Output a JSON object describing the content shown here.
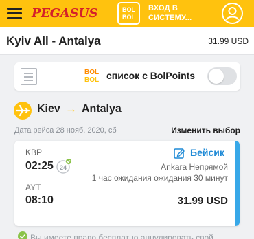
{
  "header": {
    "brand": "PEGASUS",
    "bolbol_badge": [
      "BOL",
      "BOL"
    ],
    "login_lines": [
      "ВХОД В",
      "СИСТЕМУ..."
    ]
  },
  "route": {
    "title": "Kyiv All  -  Antalya",
    "price": "31.99 USD"
  },
  "bolpoints": {
    "logo": [
      "BOL",
      "BOL"
    ],
    "label": "список с BolPoints",
    "toggle_on": false
  },
  "leg": {
    "from": "Kiev",
    "arrow": "→",
    "to": "Antalya",
    "date": "Дата рейса 28 нояб. 2020, сб",
    "change_link": "Изменить выбор"
  },
  "flight": {
    "departure_code": "KBP",
    "departure_time": "02:25",
    "badge_number": "24",
    "fare_name": "Бейсик",
    "transfer": "Ankara Непрямой",
    "layover": "1 час ожидания ожидания 30 минут",
    "arrival_code": "AYT",
    "arrival_time": "08:10",
    "price": "31.99 USD"
  },
  "notice": {
    "text": "Вы имеете право бесплатно аннулировать свой"
  },
  "colors": {
    "brand_yellow": "#ffc20e",
    "brand_red": "#d4202a",
    "fare_blue": "#1f8ad6",
    "card_accent": "#38a8e8",
    "check_green": "#8bc34a"
  },
  "icons": {
    "menu": "hamburger-menu-icon",
    "user": "user-account-icon",
    "list": "list-document-icon",
    "plane": "airplane-icon",
    "badge24": "24-hour-check-icon",
    "fare": "edit-pencil-icon",
    "notice": "checkmark-icon"
  }
}
